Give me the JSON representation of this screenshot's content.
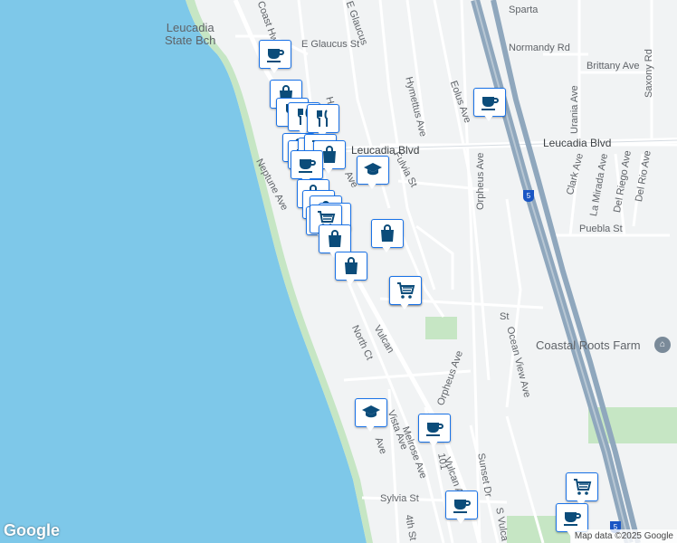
{
  "labels": [
    {
      "id": "leucadia-state-bch",
      "text": "Leucadia\nState Bch",
      "kind": "place"
    },
    {
      "id": "e-glaucus-st",
      "text": "E Glaucus St"
    },
    {
      "id": "e-glaucus-st-2",
      "text": "E Glaucus"
    },
    {
      "id": "coast-hwy",
      "text": "Coast Hw"
    },
    {
      "id": "sparta",
      "text": "Sparta"
    },
    {
      "id": "normandy-rd",
      "text": "Normandy Rd"
    },
    {
      "id": "brittany-ave",
      "text": "Brittany Ave"
    },
    {
      "id": "saxony-rd",
      "text": "Saxony Rd"
    },
    {
      "id": "urania-ave",
      "text": "Urania Ave"
    },
    {
      "id": "eolus-ave",
      "text": "Eolus Ave"
    },
    {
      "id": "hymettus-ave",
      "text": "Hymettus Ave"
    },
    {
      "id": "hermes",
      "text": "Herm"
    },
    {
      "id": "leucadia-blvd-w",
      "text": "Leucadia Blvd",
      "kind": "major"
    },
    {
      "id": "leucadia-blvd-e",
      "text": "Leucadia Blvd",
      "kind": "major"
    },
    {
      "id": "fulvia-st",
      "text": "Fulvia St"
    },
    {
      "id": "neptune-ave",
      "text": "Neptune Ave"
    },
    {
      "id": "orpheus-ave",
      "text": "Orpheus Ave"
    },
    {
      "id": "clark-ave",
      "text": "Clark Ave"
    },
    {
      "id": "la-mirada-ave",
      "text": "La Mirada Ave"
    },
    {
      "id": "del-riego-ave",
      "text": "Del Riego Ave"
    },
    {
      "id": "del-rio-ave",
      "text": "Del Rio Ave"
    },
    {
      "id": "puebla-st",
      "text": "Puebla St"
    },
    {
      "id": "ocean-view-ave",
      "text": "Ocean View Ave"
    },
    {
      "id": "coastal-roots-farm",
      "text": "Coastal Roots Farm",
      "kind": "poi"
    },
    {
      "id": "north-ct",
      "text": "North Ct"
    },
    {
      "id": "vulcan",
      "text": "Vulcan"
    },
    {
      "id": "orpheus-ave-2",
      "text": "Orpheus Ave"
    },
    {
      "id": "vista-ave",
      "text": "Vista Ave"
    },
    {
      "id": "melrose-ave",
      "text": "Melrose Ave"
    },
    {
      "id": "vulcan-ave",
      "text": "Vulcan Ave"
    },
    {
      "id": "sunset-dr",
      "text": "Sunset Dr"
    },
    {
      "id": "s-vulcan",
      "text": "S Vulca"
    },
    {
      "id": "sylvia-st",
      "text": "Sylvia St"
    },
    {
      "id": "fourth-st",
      "text": "4th St"
    },
    {
      "id": "route-101",
      "text": "101"
    },
    {
      "id": "st",
      "text": "St"
    },
    {
      "id": "ave",
      "text": "Ave"
    },
    {
      "id": "ave-2",
      "text": "Ave"
    }
  ],
  "markers": [
    {
      "icon": "cafe"
    },
    {
      "icon": "shopping-bag"
    },
    {
      "icon": "restaurant"
    },
    {
      "icon": "restaurant"
    },
    {
      "icon": "restaurant"
    },
    {
      "icon": "shopping-bag"
    },
    {
      "icon": "cafe"
    },
    {
      "icon": "shopping-bag"
    },
    {
      "icon": "shopping-cart"
    },
    {
      "icon": "shopping-bag"
    },
    {
      "icon": "cafe"
    },
    {
      "icon": "school"
    },
    {
      "icon": "shopping-bag"
    },
    {
      "icon": "shopping-bag"
    },
    {
      "icon": "shopping-bag"
    },
    {
      "icon": "shopping-bag"
    },
    {
      "icon": "shopping-bag"
    },
    {
      "icon": "shopping-cart"
    },
    {
      "icon": "shopping-bag"
    },
    {
      "icon": "shopping-bag"
    },
    {
      "icon": "shopping-cart"
    },
    {
      "icon": "shopping-bag"
    },
    {
      "icon": "shopping-cart"
    },
    {
      "icon": "cafe"
    },
    {
      "icon": "school"
    },
    {
      "icon": "cafe"
    },
    {
      "icon": "cafe"
    },
    {
      "icon": "shopping-cart"
    },
    {
      "icon": "cafe"
    }
  ],
  "shields": [
    {
      "id": "i5-shield-1",
      "text": "5"
    },
    {
      "id": "i5-shield-2",
      "text": "5"
    }
  ],
  "google_logo": "Google",
  "attribution": "Map data ©2025 Google",
  "colors": {
    "water": "#7ec8e9",
    "land": "#f1f3f4",
    "park": "#c6e6c4",
    "freeway": "#8fa7bd",
    "road": "#ffffff",
    "marker_border": "#1a73e8",
    "marker_icon": "#0b4c7a"
  }
}
